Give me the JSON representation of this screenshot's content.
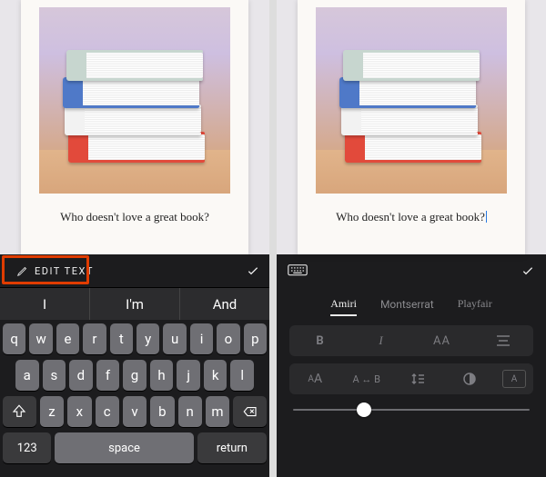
{
  "caption": "Who doesn't love a great book?",
  "books": [
    {
      "color": "#c7d6cf"
    },
    {
      "color": "#4f79c8"
    },
    {
      "color": "#f2f2f2"
    },
    {
      "color": "#e24a3b"
    }
  ],
  "left": {
    "edit_label": "EDIT TEXT",
    "suggestions": [
      "I",
      "I'm",
      "And"
    ],
    "keyboard": {
      "row1": [
        "q",
        "w",
        "e",
        "r",
        "t",
        "y",
        "u",
        "i",
        "o",
        "p"
      ],
      "row2": [
        "a",
        "s",
        "d",
        "f",
        "g",
        "h",
        "j",
        "k",
        "l"
      ],
      "row3": [
        "z",
        "x",
        "c",
        "v",
        "b",
        "n",
        "m"
      ],
      "numbers": "123",
      "space": "space",
      "return": "return"
    }
  },
  "right": {
    "fonts": [
      "Amiri",
      "Montserrat",
      "Playfair"
    ],
    "active_font_index": 0,
    "style_row1": {
      "bold": "B",
      "italic": "I",
      "caps": "AA"
    },
    "style_row2": {
      "size_label_small": "A",
      "size_label_big": "A",
      "ab_swap": "A ↔ B",
      "boxed": "A"
    },
    "slider_value": 0.3
  }
}
